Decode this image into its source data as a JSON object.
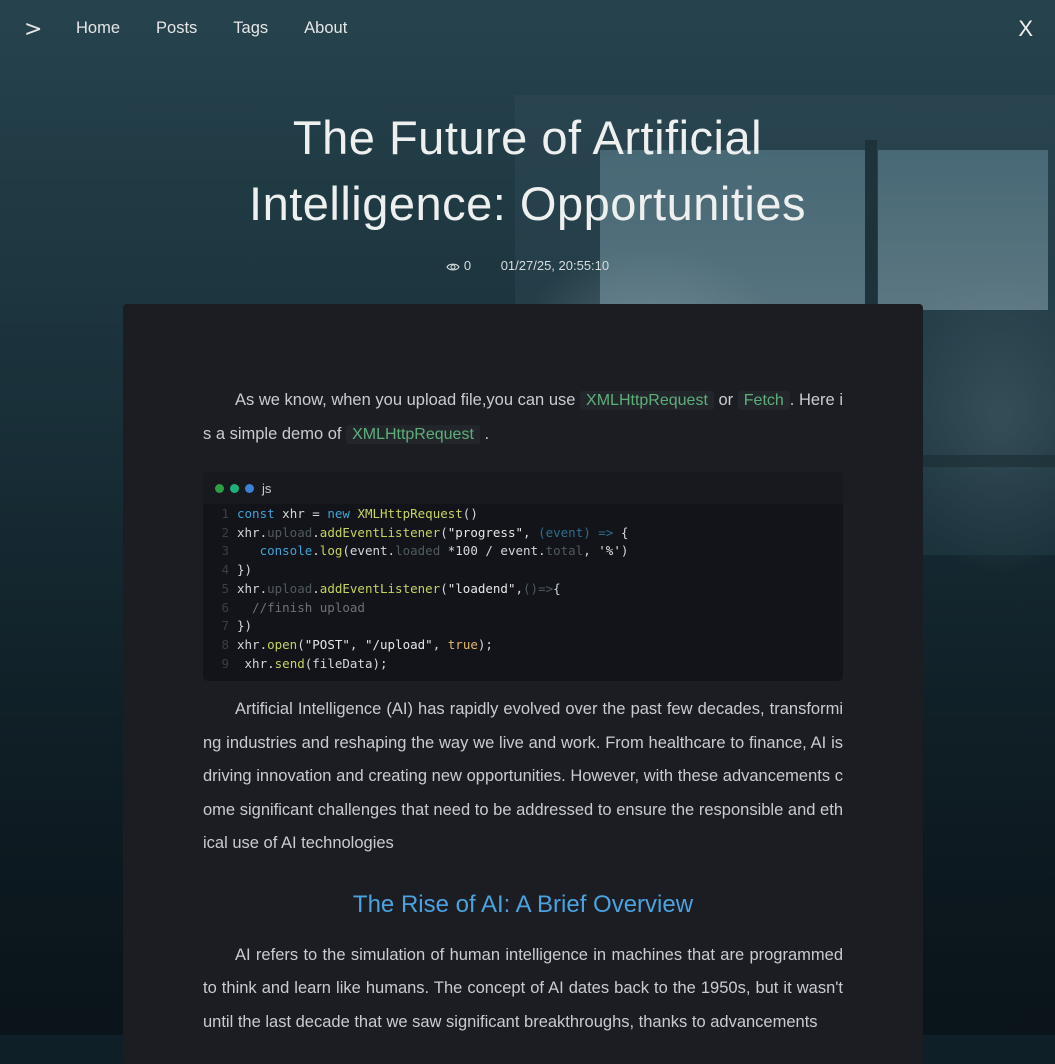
{
  "nav": {
    "toggle_icon": "chevron-right-icon",
    "toggle_glyph": ">",
    "links": [
      "Home",
      "Posts",
      "Tags",
      "About"
    ],
    "close_glyph": "X"
  },
  "post": {
    "title": "The Future of Artificial Intelligence: Opportunities",
    "views": "0",
    "date": "01/27/25, 20:55:10",
    "intro": {
      "t1": "As we know, when you upload file,you can use ",
      "code1": "XMLHttpRequest",
      "t2": " or ",
      "code2": "Fetch",
      "t3": ". Here is a simple demo of ",
      "code3": "XMLHttpRequest",
      "t4": " ."
    },
    "code": {
      "lang": "js",
      "dot_colors": [
        "#2f9e44",
        "#1fb37a",
        "#3b82d6"
      ],
      "line_numbers": [
        "1",
        "2",
        "3",
        "4",
        "5",
        "6",
        "7",
        "8",
        "9"
      ],
      "l1": {
        "a": "const",
        "b": " xhr = ",
        "c": "new",
        "d": " ",
        "e": "XMLHttpRequest",
        "f": "()"
      },
      "l2": {
        "a": "xhr.",
        "b": "upload",
        "c": ".",
        "d": "addEventListener",
        "e": "(",
        "f": "\"progress\"",
        "g": ", ",
        "h": "(event) =>",
        "i": " {"
      },
      "l3": {
        "a": "   ",
        "b": "console",
        "c": ".",
        "d": "log",
        "e": "(event.",
        "f": "loaded",
        "g": " *100 / event.",
        "h": "total",
        "i": ", ",
        "j": "'%'",
        "k": ")"
      },
      "l4": "})",
      "l5": {
        "a": "xhr.",
        "b": "upload",
        "c": ".",
        "d": "addEventListener",
        "e": "(",
        "f": "\"loadend\"",
        "g": ",",
        "h": "()=>",
        "i": "{"
      },
      "l6": "  //finish upload",
      "l7": "})",
      "l8": {
        "a": "xhr.",
        "b": "open",
        "c": "(",
        "d": "\"POST\"",
        "e": ", ",
        "f": "\"/upload\"",
        "g": ", ",
        "h": "true",
        "i": ");"
      },
      "l9": {
        "a": " xhr.",
        "b": "send",
        "c": "(fileData);"
      }
    },
    "para1": "Artificial Intelligence (AI) has rapidly evolved over the past few decades, transforming industries and reshaping the way we live and work. From healthcare to finance, AI is driving innovation and creating new opportunities. However, with these advancements come significant challenges that need to be addressed to ensure the responsible and ethical use of AI technologies",
    "heading": "The Rise of AI: A Brief Overview",
    "para2": "AI refers to the simulation of human intelligence in machines that are programmed to think and learn like humans. The concept of AI dates back to the 1950s, but it wasn't until the last decade that we saw significant breakthroughs, thanks to advancements"
  }
}
